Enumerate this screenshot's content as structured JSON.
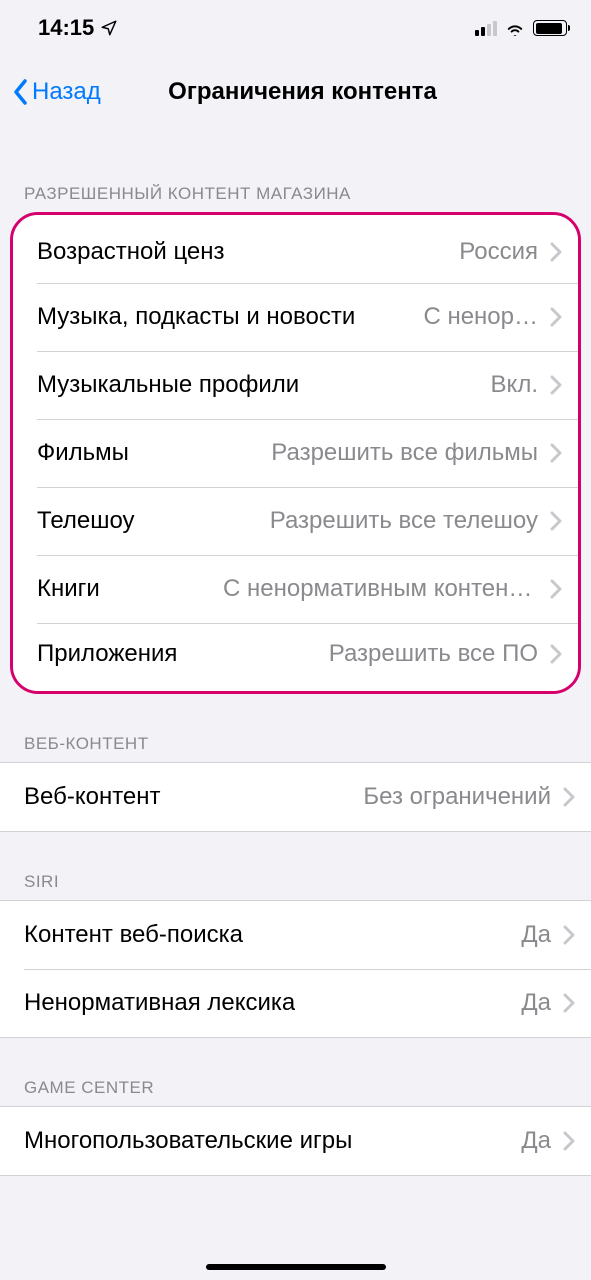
{
  "statusBar": {
    "time": "14:15"
  },
  "nav": {
    "back": "Назад",
    "title": "Ограничения контента"
  },
  "sections": {
    "store": {
      "header": "РАЗРЕШЕННЫЙ КОНТЕНТ МАГАЗИНА",
      "rows": [
        {
          "label": "Возрастной ценз",
          "value": "Россия"
        },
        {
          "label": "Музыка, подкасты и новости",
          "value": "С ненор…"
        },
        {
          "label": "Музыкальные профили",
          "value": "Вкл."
        },
        {
          "label": "Фильмы",
          "value": "Разрешить все фильмы"
        },
        {
          "label": "Телешоу",
          "value": "Разрешить все телешоу"
        },
        {
          "label": "Книги",
          "value": "С ненормативным контентом"
        },
        {
          "label": "Приложения",
          "value": "Разрешить все ПО"
        }
      ]
    },
    "web": {
      "header": "ВЕБ-КОНТЕНТ",
      "rows": [
        {
          "label": "Веб-контент",
          "value": "Без ограничений"
        }
      ]
    },
    "siri": {
      "header": "SIRI",
      "rows": [
        {
          "label": "Контент веб-поиска",
          "value": "Да"
        },
        {
          "label": "Ненормативная лексика",
          "value": "Да"
        }
      ]
    },
    "gamecenter": {
      "header": "GAME CENTER",
      "rows": [
        {
          "label": "Многопользовательские игры",
          "value": "Да"
        }
      ]
    }
  }
}
